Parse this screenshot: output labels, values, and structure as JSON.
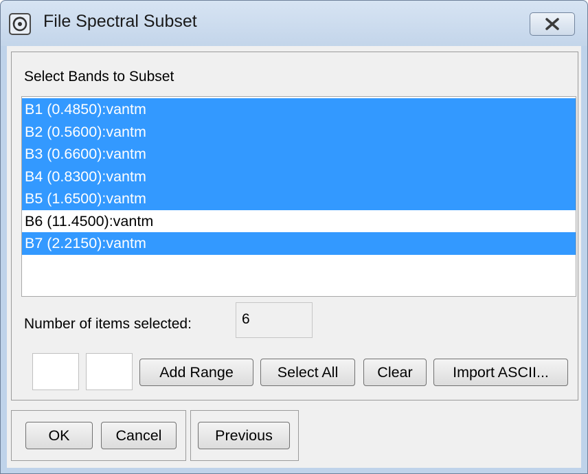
{
  "window": {
    "title": "File Spectral Subset",
    "close_icon": "close-x-icon"
  },
  "bands": {
    "label": "Select Bands to Subset",
    "items": [
      {
        "label": "B1 (0.4850):vantm",
        "selected": true
      },
      {
        "label": "B2 (0.5600):vantm",
        "selected": true
      },
      {
        "label": "B3 (0.6600):vantm",
        "selected": true
      },
      {
        "label": "B4 (0.8300):vantm",
        "selected": true
      },
      {
        "label": "B5 (1.6500):vantm",
        "selected": true
      },
      {
        "label": "B6 (11.4500):vantm",
        "selected": false
      },
      {
        "label": "B7 (2.2150):vantm",
        "selected": true
      }
    ],
    "count_label": "Number of items selected:",
    "count_value": "6",
    "range_start_value": "",
    "range_end_value": ""
  },
  "buttons": {
    "add_range": "Add Range",
    "select_all": "Select All",
    "clear": "Clear",
    "import_ascii": "Import ASCII...",
    "ok": "OK",
    "cancel": "Cancel",
    "previous": "Previous"
  },
  "colors": {
    "selection": "#3399ff",
    "selection_text": "#ffffff",
    "frame": "#bfd3ea"
  }
}
